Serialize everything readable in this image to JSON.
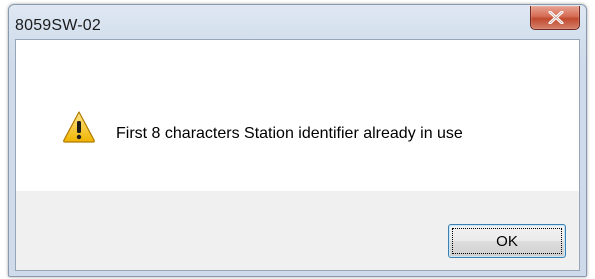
{
  "window": {
    "title": "8059SW-02"
  },
  "icons": {
    "close": "close-icon",
    "message": "warning-icon"
  },
  "dialog": {
    "message": "First 8 characters Station identifier already in use",
    "ok_label": "OK"
  },
  "colors": {
    "close_button": "#c94c33",
    "warning_fill": "#f4c430",
    "ok_border": "#3c7fb1"
  }
}
